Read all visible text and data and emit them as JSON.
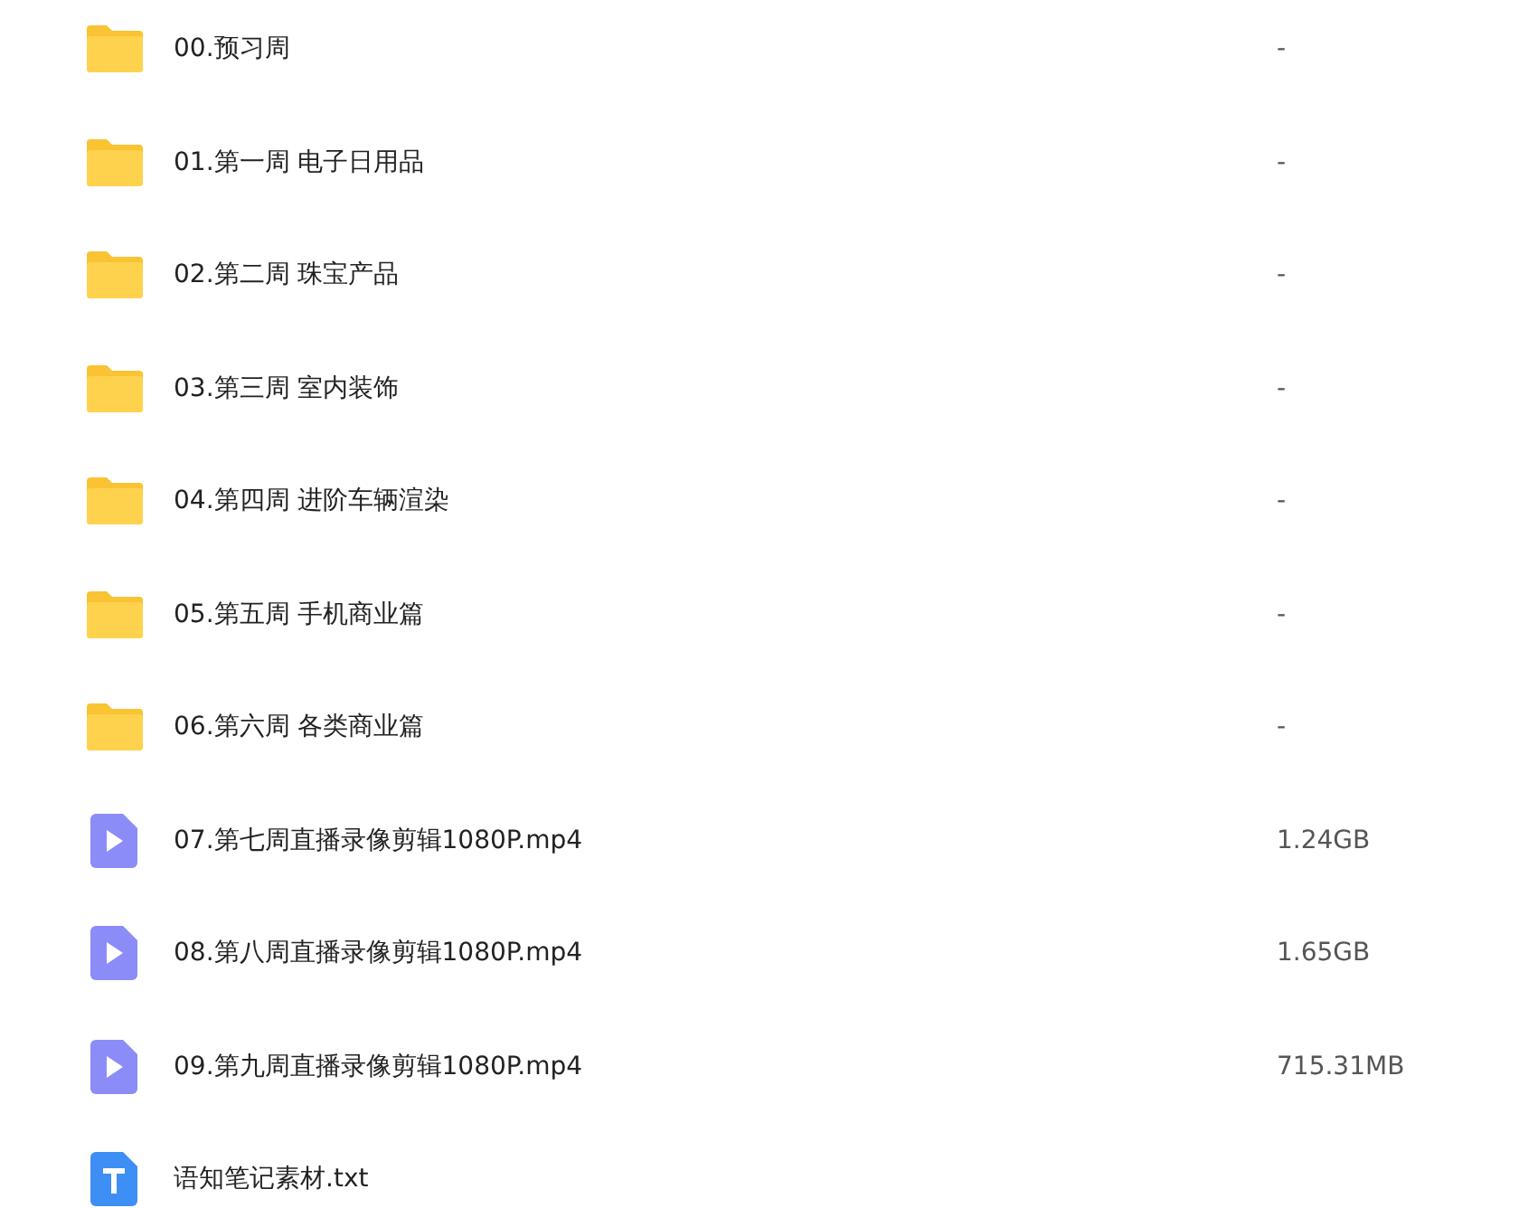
{
  "files": [
    {
      "kind": "folder",
      "name": "00.预习周",
      "size": "-"
    },
    {
      "kind": "folder",
      "name": "01.第一周 电子日用品",
      "size": "-"
    },
    {
      "kind": "folder",
      "name": "02.第二周 珠宝产品",
      "size": "-"
    },
    {
      "kind": "folder",
      "name": "03.第三周 室内装饰",
      "size": "-"
    },
    {
      "kind": "folder",
      "name": "04.第四周 进阶车辆渲染",
      "size": "-"
    },
    {
      "kind": "folder",
      "name": "05.第五周 手机商业篇",
      "size": "-"
    },
    {
      "kind": "folder",
      "name": "06.第六周 各类商业篇",
      "size": "-"
    },
    {
      "kind": "video",
      "name": "07.第七周直播录像剪辑1080P.mp4",
      "size": "1.24GB"
    },
    {
      "kind": "video",
      "name": "08.第八周直播录像剪辑1080P.mp4",
      "size": "1.65GB"
    },
    {
      "kind": "video",
      "name": "09.第九周直播录像剪辑1080P.mp4",
      "size": "715.31MB"
    },
    {
      "kind": "text",
      "name": "语知笔记素材.txt"
    }
  ]
}
